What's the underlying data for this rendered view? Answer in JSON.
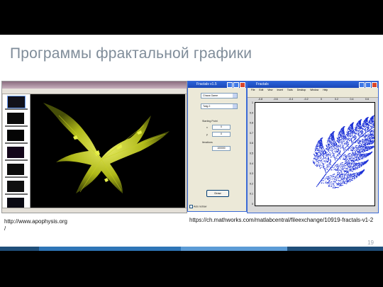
{
  "slide": {
    "title": "Программы фрактальной графики",
    "page_number": "19"
  },
  "captions": {
    "left_url": "http://www.apophysis.org/",
    "left_url_line1": "http://www.apophysis.org",
    "left_url_line2": "/",
    "right_url": "https://ch.mathworks.com/matlabcentral/fileexchange/10919-fractals-v1-2"
  },
  "fractals_dialog": {
    "title": "Fractals v1.5",
    "combo1": "Chaos Game",
    "combo2": "Twig 2",
    "starting_point_label": "Starting Point",
    "x_label": "x",
    "x_value": "0",
    "y_label": "y",
    "y_value": "0",
    "iterations_label": "Iterations",
    "iterations_value": "100000",
    "draw_button": "Draw",
    "auto_redraw": "Auto redraw"
  },
  "matlab_figure": {
    "title": "Fractals",
    "menu": [
      "File",
      "Edit",
      "View",
      "Insert",
      "Tools",
      "Desktop",
      "Window",
      "Help"
    ],
    "x_ticks": [
      "-0.8",
      "-0.6",
      "-0.4",
      "-0.2",
      "0",
      "0.2",
      "0.4",
      "0.6"
    ],
    "y_ticks": [
      "1",
      "0.9",
      "0.8",
      "0.7",
      "0.6",
      "0.5",
      "0.4",
      "0.3",
      "0.2",
      "0.1",
      "0"
    ]
  },
  "colors": {
    "title": "#7f8c99",
    "bar": [
      "#1f4e79",
      "#2e75b6",
      "#5b9bd5",
      "#1f4e79"
    ],
    "fractal_yellow": "#d7e21f",
    "fern_blue": "#1a2fd6"
  }
}
